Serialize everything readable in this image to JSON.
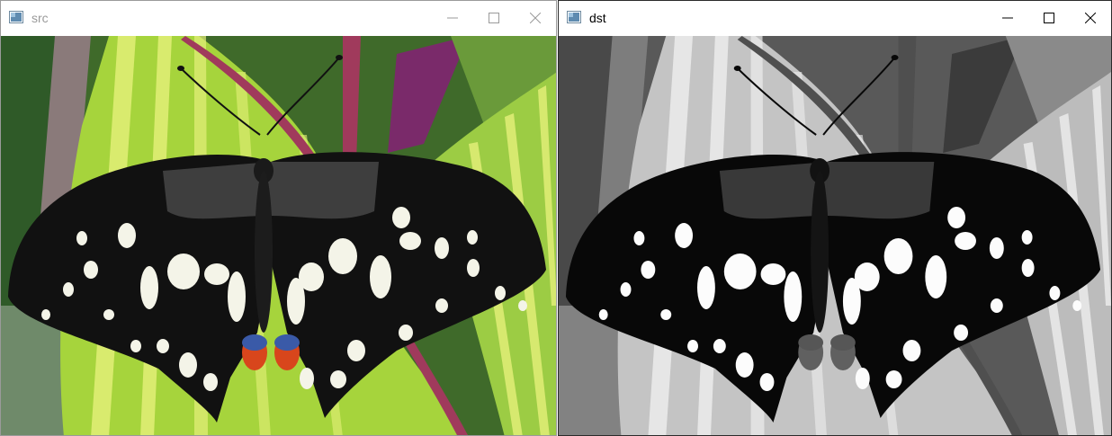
{
  "windows": [
    {
      "title": "src"
    },
    {
      "title": "dst"
    }
  ],
  "colors": {
    "leaf_green": "#a6d43c",
    "leaf_stripe": "#e6f07a",
    "leaf_edge": "#a03a5c",
    "background_green": "#3f6a2a",
    "wing_black": "#111111",
    "wing_spot": "#f4f4e8",
    "eyespot_orange": "#d8461c",
    "eyespot_blue": "#3a5aa8"
  },
  "icons": [
    "app-icon",
    "minimize-icon",
    "maximize-icon",
    "close-icon"
  ]
}
